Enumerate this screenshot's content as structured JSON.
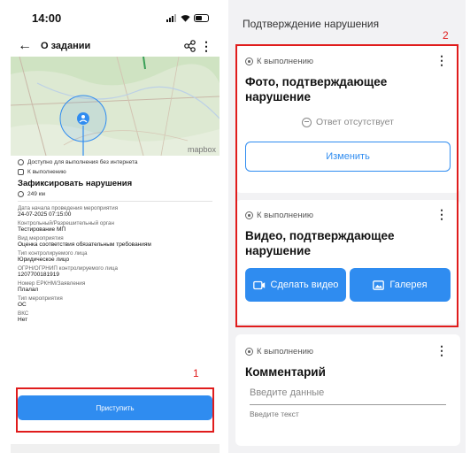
{
  "left": {
    "status_bar": {
      "time": "14:00"
    },
    "header": {
      "title": "О задании"
    },
    "offline_note": "Доступно для выполнения без интернета",
    "task_status": "К выполнению",
    "task_title": "Зафиксировать нарушения",
    "distance": "249 км",
    "map_attribution": "mapbox",
    "fields": [
      {
        "label": "Дата начала проведения мероприятия",
        "value": "24-07-2025 07:15:00"
      },
      {
        "label": "Контрольный/Разрешительный орган",
        "value": "Тестирование МП"
      },
      {
        "label": "Вид мероприятия",
        "value": "Оценка соответствия обязательным требованиям"
      },
      {
        "label": "Тип контролируемого лица",
        "value": "Юридическое лицо"
      },
      {
        "label": "ОГРН/ОГРНИП контролируемого лица",
        "value": "1207700181919"
      },
      {
        "label": "Номер ЕРКНМ/Заявления",
        "value": "Плалал"
      },
      {
        "label": "Тип мероприятия",
        "value": "ОС"
      },
      {
        "label": "ВКС",
        "value": "Нет"
      }
    ],
    "start_button": "Приступить",
    "annotation_number": "1"
  },
  "right": {
    "section_title": "Подтверждение нарушения",
    "cards": [
      {
        "status": "К выполнению",
        "title": "Фото, подтверждающее нарушение",
        "no_answer": "Ответ отсутствует",
        "action": "Изменить"
      },
      {
        "status": "К выполнению",
        "title": "Видео, подтверждающее нарушение",
        "record_video": "Сделать видео",
        "gallery": "Галерея"
      },
      {
        "status": "К выполнению",
        "title": "Комментарий",
        "input_placeholder": "Введите данные",
        "input_hint": "Введите текст"
      }
    ],
    "annotation_number": "2"
  },
  "colors": {
    "accent": "#2f8cf0",
    "highlight": "#e01c1c"
  }
}
